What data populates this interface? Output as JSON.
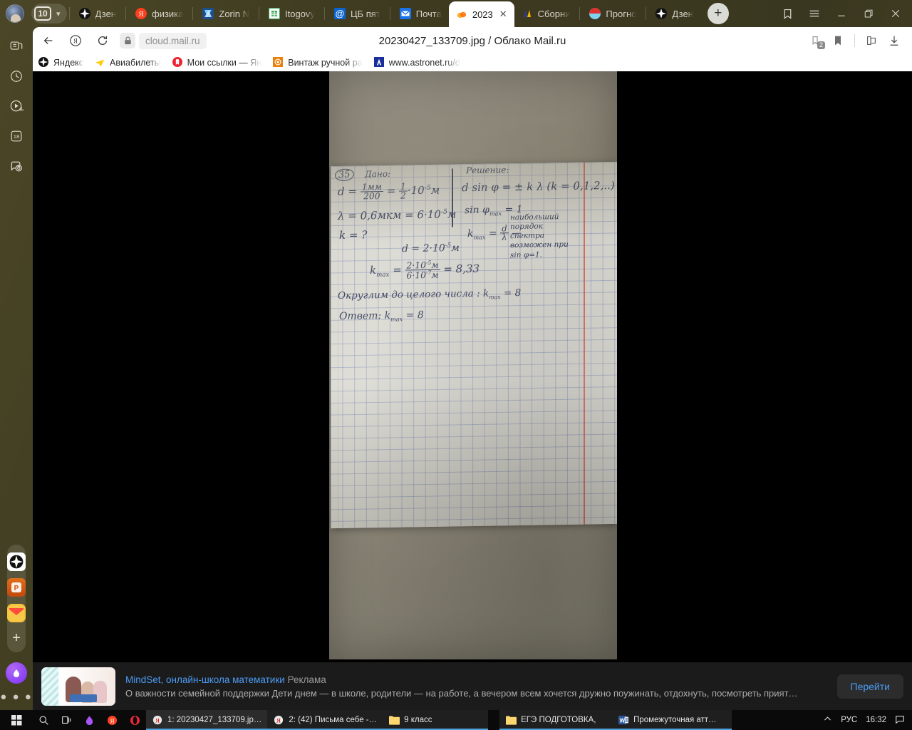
{
  "browser": {
    "tab_count": "10",
    "tabs": [
      {
        "label": "Дзен",
        "icon": "zen-icon",
        "active": false
      },
      {
        "label": "физика",
        "icon": "yandex-icon",
        "active": false
      },
      {
        "label": "Zorin N",
        "icon": "zorin-icon",
        "active": false
      },
      {
        "label": "Itogovy",
        "icon": "sheets-icon",
        "active": false
      },
      {
        "label": "ЦБ пят",
        "icon": "at-icon",
        "active": false
      },
      {
        "label": "Почта",
        "icon": "mail-icon",
        "active": false
      },
      {
        "label": "2023",
        "icon": "cloud-mail-icon",
        "active": true
      },
      {
        "label": "Сборни",
        "icon": "sborni-icon",
        "active": false
      },
      {
        "label": "Прогно",
        "icon": "weather-icon",
        "active": false
      },
      {
        "label": "Дзен",
        "icon": "zen-icon",
        "active": false
      }
    ],
    "new_tab_label": "+",
    "window_controls": {
      "collections": "collections-icon",
      "menu": "hamburger-menu-icon",
      "minimize": "minimize-icon",
      "maximize": "maximize-icon",
      "close": "close-icon"
    }
  },
  "toolbar": {
    "back": "back-arrow-icon",
    "yandex_home": "yandex-circle-icon",
    "reload": "reload-icon",
    "lock": "lock-icon",
    "url": "cloud.mail.ru",
    "page_title": "20230427_133709.jpg / Облако Mail.ru",
    "right_icons": {
      "bookmark_stack": "bookmark-stack-icon",
      "bookmark_stack_badge": "2",
      "bookmark": "bookmark-filled-icon",
      "reader": "reader-mode-icon",
      "download": "download-icon"
    }
  },
  "bookmarks": [
    {
      "label": "Яндекс",
      "icon": "yandex-star-icon"
    },
    {
      "label": "Авиабилеты",
      "icon": "plane-icon"
    },
    {
      "label": "Мои ссылки — Ян",
      "icon": "links-icon"
    },
    {
      "label": "Винтаж ручной ра",
      "icon": "vintage-icon"
    },
    {
      "label": "www.astronet.ru/d",
      "icon": "astronet-icon"
    }
  ],
  "sidebar": {
    "top_items": [
      {
        "name": "notes-icon"
      },
      {
        "name": "history-clock-icon"
      },
      {
        "name": "media-player-icon"
      },
      {
        "name": "calendar-18-icon",
        "label": "18"
      },
      {
        "name": "screenshot-camera-icon"
      }
    ],
    "bottom_items": [
      {
        "name": "zen-app-icon"
      },
      {
        "name": "punto-switcher-icon"
      },
      {
        "name": "mail-app-icon"
      },
      {
        "name": "add-service-plus-icon",
        "label": "+"
      },
      {
        "name": "alice-assistant-icon"
      },
      {
        "name": "more-options-icon",
        "label": "● ● ●"
      }
    ]
  },
  "photo": {
    "description": "Фотография тетрадного листа в клетку с рукописным решением задачи по физике",
    "handwriting": {
      "task_number": "35",
      "given_label": "Дано:",
      "solution_label": "Решение:",
      "lines": [
        {
          "text": "d = 1мм/200 = 1/2·10⁻⁵ м"
        },
        {
          "text": "λ = 0,6мкм = 6·10⁻⁵ м"
        },
        {
          "text": "k = ?"
        },
        {
          "text": "d sin φ = ± k λ  (k = 0,1,2,...)"
        },
        {
          "text": "sin φmax = 1"
        },
        {
          "text": "kmax = d / λ"
        },
        {
          "text": "наибольший порядок спектра возможен при sin φ = 1"
        },
        {
          "text": "d = 2·10⁻⁵ м"
        },
        {
          "text": "kmax = 2·10⁻⁵ м / 6·10⁻⁷ м = 8,33"
        },
        {
          "text": "Округлим до целого числа : kmax = 8"
        },
        {
          "text": "Ответ: kmax = 8"
        }
      ]
    }
  },
  "ad": {
    "title": "MindSet, онлайн-школа математики",
    "label": "Реклама",
    "description": "О важности семейной поддержки Дети днем — в школе, родители — на работе, а вечером всем хочется дружно поужинать, отдохнуть, посмотреть прият…",
    "button": "Перейти",
    "thumbnail": "family-reading-photo"
  },
  "taskbar": {
    "start": "windows-start-icon",
    "search": "search-icon",
    "task_view": "task-view-icon",
    "pinned": [
      {
        "name": "alice-taskbar-icon"
      },
      {
        "name": "yandex-browser-taskbar-icon"
      },
      {
        "name": "opera-taskbar-icon"
      }
    ],
    "windows": [
      {
        "label": "1: 20230427_133709.jp…",
        "icon": "yandex-browser-icon",
        "active": true
      },
      {
        "label": "2: (42) Письма себе -…",
        "icon": "yandex-browser-icon",
        "active": false
      },
      {
        "label": "9 класс",
        "icon": "folder-icon",
        "active": false
      },
      {
        "label": "ЕГЭ ПОДГОТОВКА,",
        "icon": "folder-icon",
        "active": false
      },
      {
        "label": "Промежуточная атт…",
        "icon": "word-icon",
        "active": false
      }
    ],
    "tray": {
      "chevron": "show-hidden-icons-icon",
      "language": "РУС",
      "time": "16:32",
      "notifications": "notification-icon"
    }
  }
}
